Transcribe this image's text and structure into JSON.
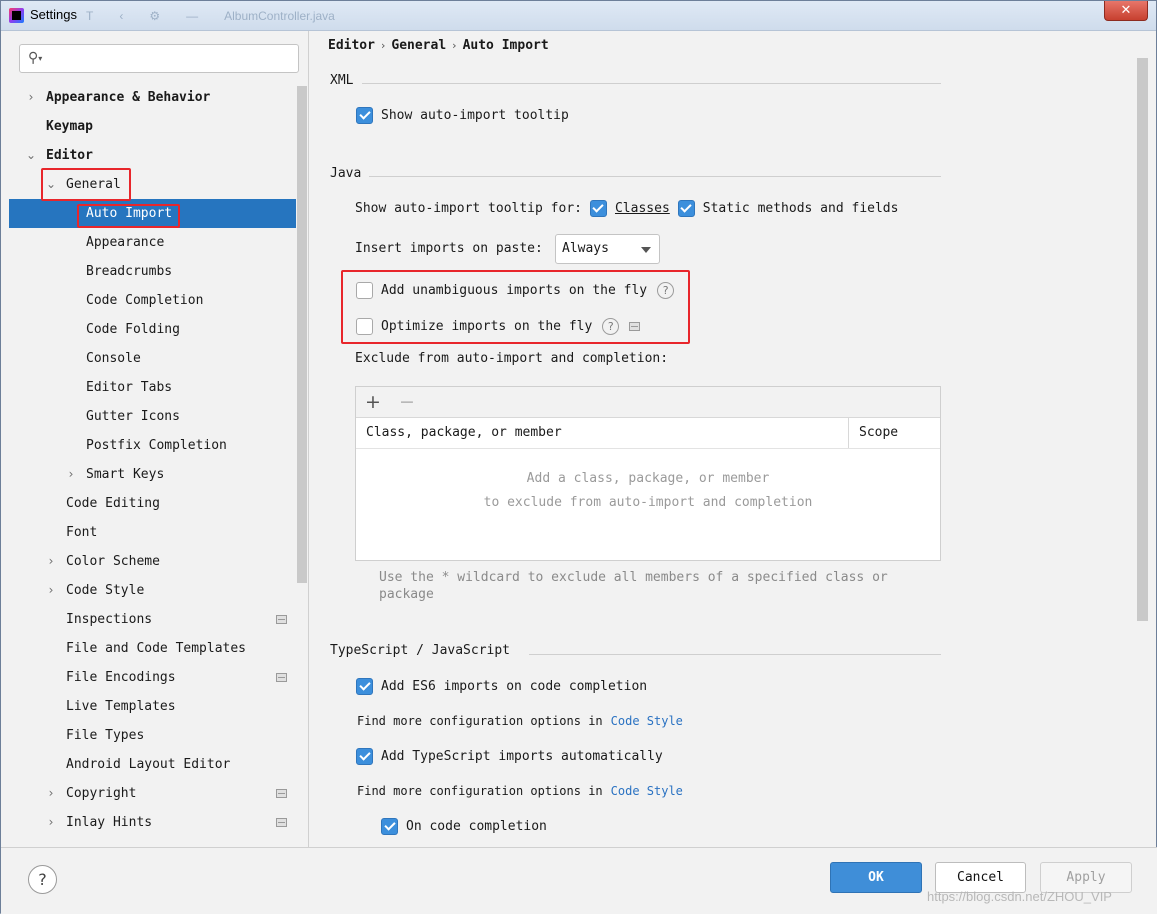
{
  "window": {
    "title": "Settings",
    "ghost_toolbar": [
      "T",
      "‹",
      "⚙",
      "—",
      "AlbumController.java"
    ],
    "close_label": "✕"
  },
  "sidebar": {
    "search_placeholder": "",
    "items": [
      {
        "label": "Appearance & Behavior",
        "arrow": "›",
        "level": 0,
        "bold": true
      },
      {
        "label": "Keymap",
        "arrow": "",
        "level": 0,
        "bold": true
      },
      {
        "label": "Editor",
        "arrow": "⌄",
        "level": 0,
        "bold": true
      },
      {
        "label": "General",
        "arrow": "⌄",
        "level": 1
      },
      {
        "label": "Auto Import",
        "arrow": "",
        "level": 2,
        "selected": true
      },
      {
        "label": "Appearance",
        "arrow": "",
        "level": 2
      },
      {
        "label": "Breadcrumbs",
        "arrow": "",
        "level": 2
      },
      {
        "label": "Code Completion",
        "arrow": "",
        "level": 2
      },
      {
        "label": "Code Folding",
        "arrow": "",
        "level": 2
      },
      {
        "label": "Console",
        "arrow": "",
        "level": 2
      },
      {
        "label": "Editor Tabs",
        "arrow": "",
        "level": 2
      },
      {
        "label": "Gutter Icons",
        "arrow": "",
        "level": 2
      },
      {
        "label": "Postfix Completion",
        "arrow": "",
        "level": 2
      },
      {
        "label": "Smart Keys",
        "arrow": "›",
        "level": 2
      },
      {
        "label": "Code Editing",
        "arrow": "",
        "level": 1
      },
      {
        "label": "Font",
        "arrow": "",
        "level": 1
      },
      {
        "label": "Color Scheme",
        "arrow": "›",
        "level": 1
      },
      {
        "label": "Code Style",
        "arrow": "›",
        "level": 1
      },
      {
        "label": "Inspections",
        "arrow": "",
        "level": 1,
        "project": true
      },
      {
        "label": "File and Code Templates",
        "arrow": "",
        "level": 1
      },
      {
        "label": "File Encodings",
        "arrow": "",
        "level": 1,
        "project": true
      },
      {
        "label": "Live Templates",
        "arrow": "",
        "level": 1
      },
      {
        "label": "File Types",
        "arrow": "",
        "level": 1
      },
      {
        "label": "Android Layout Editor",
        "arrow": "",
        "level": 1
      },
      {
        "label": "Copyright",
        "arrow": "›",
        "level": 1,
        "project": true
      },
      {
        "label": "Inlay Hints",
        "arrow": "›",
        "level": 1,
        "project": true
      }
    ]
  },
  "breadcrumb": [
    "Editor",
    "General",
    "Auto Import"
  ],
  "breadcrumb_sep": "›",
  "xml": {
    "title": "XML",
    "show_tooltip": {
      "label": "Show auto-import tooltip",
      "checked": true
    }
  },
  "java": {
    "title": "Java",
    "tooltip_for_label": "Show auto-import tooltip for:",
    "classes": {
      "label": "Classes",
      "checked": true
    },
    "static_methods": {
      "label": "Static methods and fields",
      "checked": true
    },
    "insert_imports_label": "Insert imports on paste:",
    "insert_imports_value": "Always",
    "add_unambiguous": {
      "label": "Add unambiguous imports on the fly",
      "checked": false
    },
    "optimize_imports": {
      "label": "Optimize imports on the fly",
      "checked": false
    },
    "exclude_label": "Exclude from auto-import and completion:",
    "table": {
      "add": "+",
      "remove": "−",
      "columns": [
        "Class, package, or member",
        "Scope"
      ],
      "empty_line1": "Add a class, package, or member",
      "empty_line2": "to exclude from auto-import and completion"
    },
    "hint_line1": "Use the * wildcard to exclude all members of a specified class or",
    "hint_line2": "package"
  },
  "typescript": {
    "title": "TypeScript / JavaScript",
    "es6": {
      "label": "Add ES6 imports on code completion",
      "checked": true
    },
    "more_options_1": "Find more configuration options in",
    "code_style_link_1": "Code Style",
    "ts_auto": {
      "label": "Add TypeScript imports automatically",
      "checked": true
    },
    "more_options_2": "Find more configuration options in",
    "code_style_link_2": "Code Style",
    "on_completion": {
      "label": "On code completion",
      "checked": true
    }
  },
  "footer": {
    "help": "?",
    "ok": "OK",
    "cancel": "Cancel",
    "apply": "Apply",
    "watermark": "https://blog.csdn.net/ZHOU_VIP"
  },
  "colors": {
    "selection": "#2675bf",
    "checkbox_on": "#3c8fdc",
    "annotation_red": "#e8262b",
    "link": "#2a72c2"
  }
}
